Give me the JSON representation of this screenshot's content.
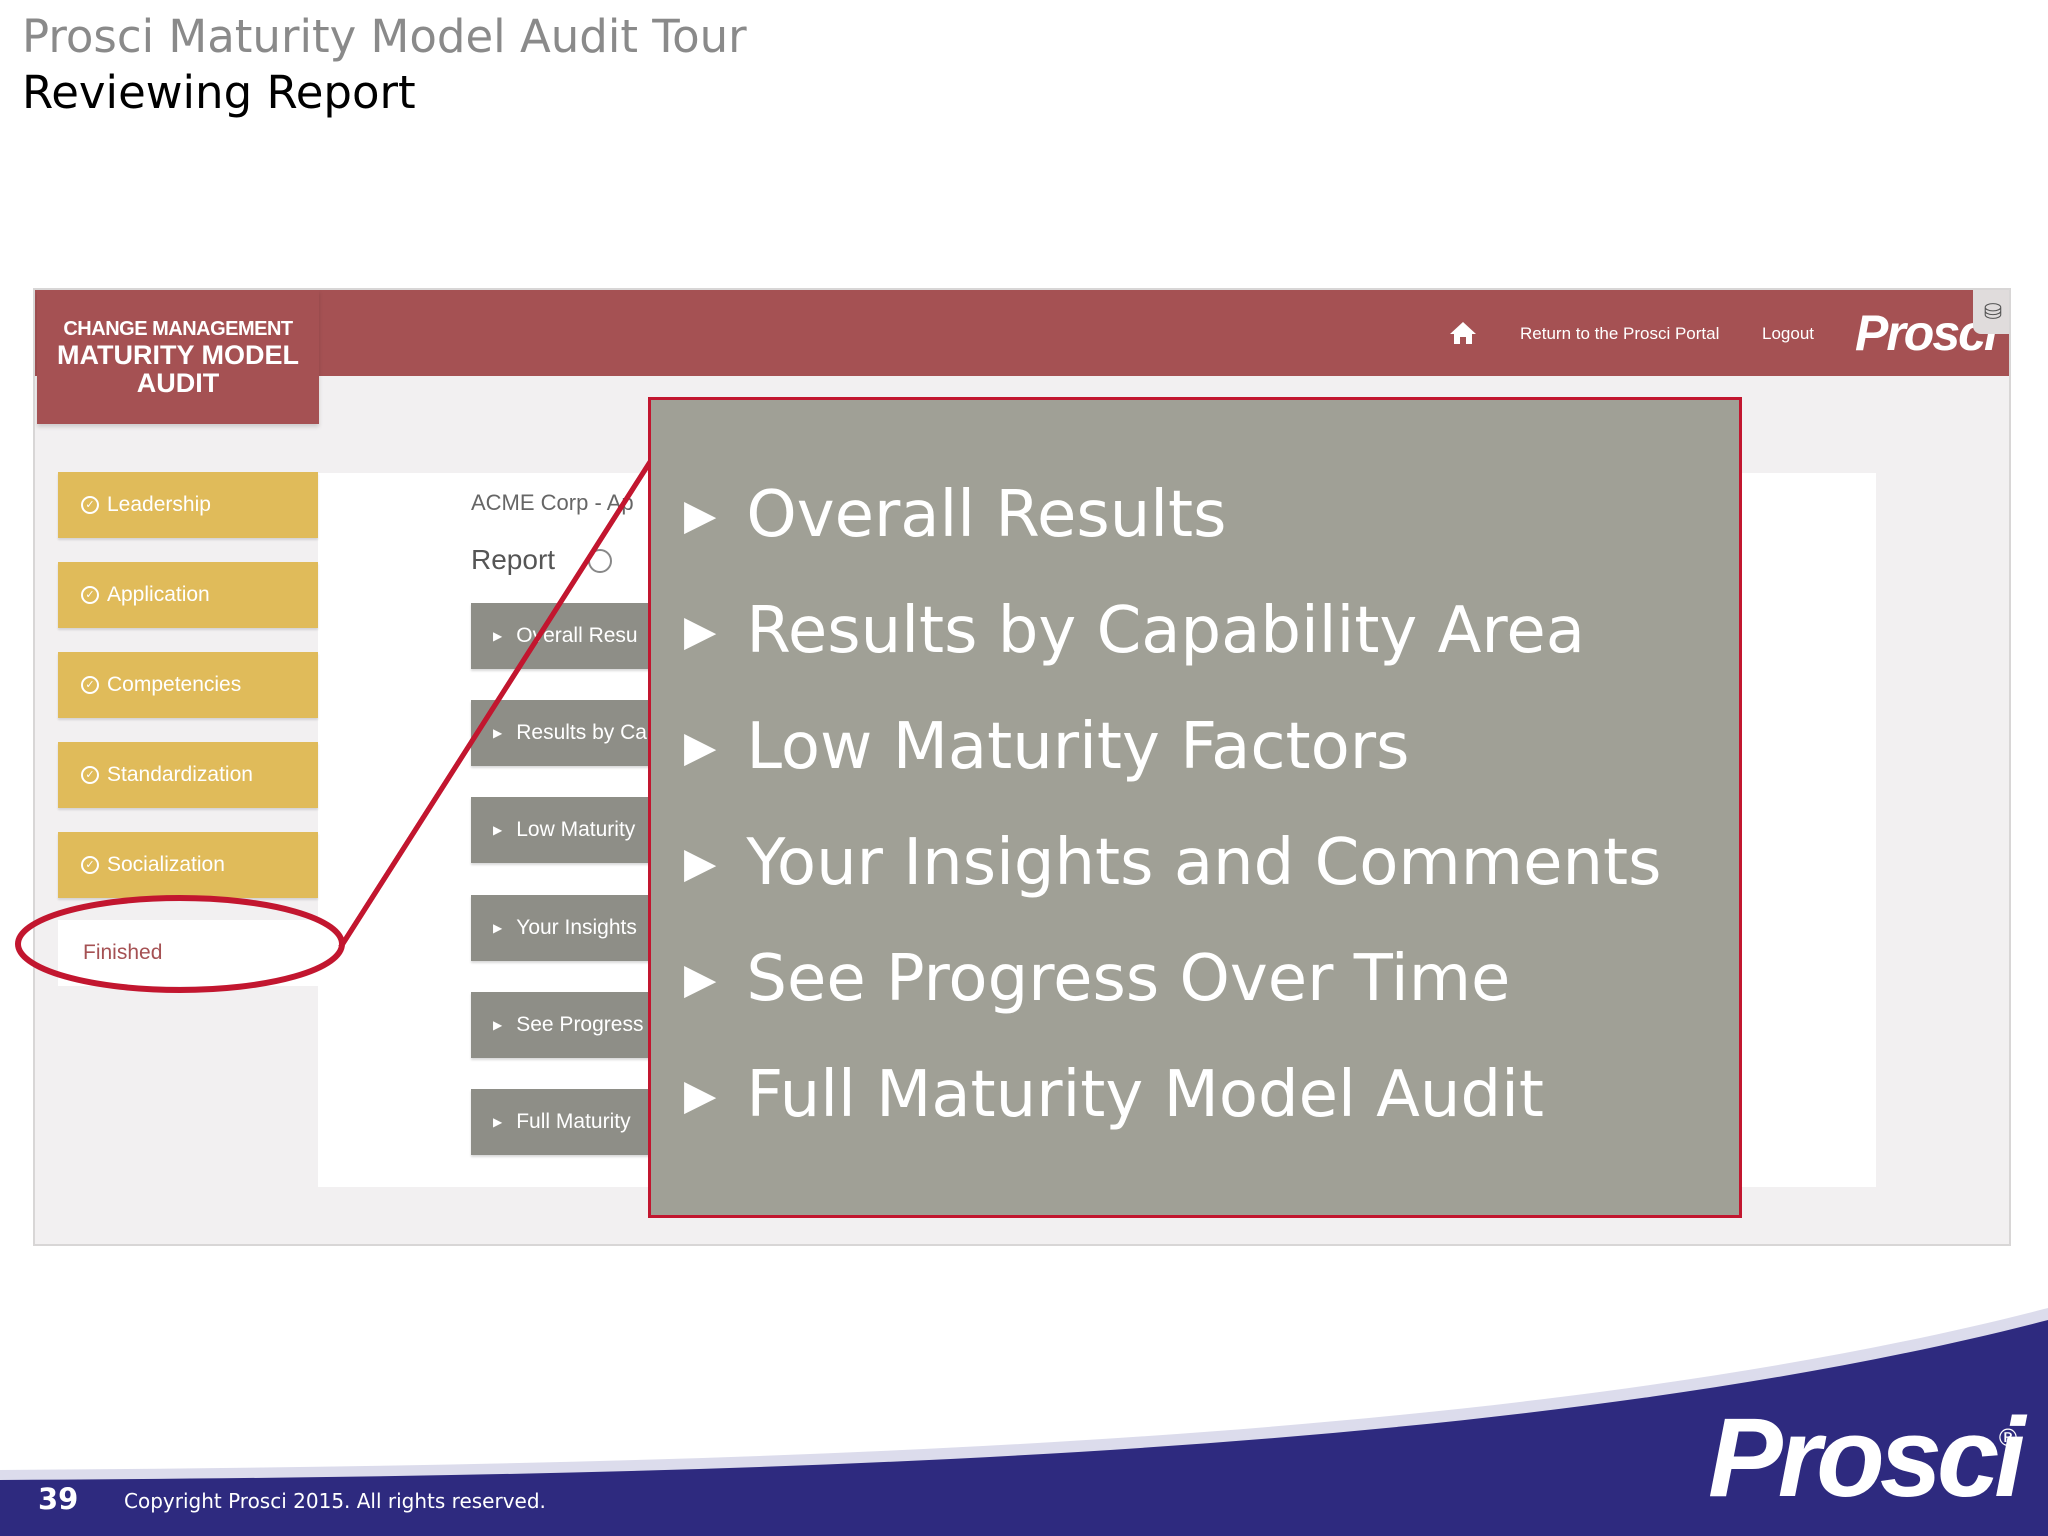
{
  "slide": {
    "title": "Prosci Maturity Model Audit Tour",
    "subtitle": "Reviewing Report"
  },
  "app": {
    "logo": {
      "line1": "CHANGE MANAGEMENT",
      "line2": "MATURITY MODEL",
      "line3": "AUDIT"
    },
    "header": {
      "home_icon": "home-icon",
      "portal_link": "Return to the Prosci Portal",
      "logout_link": "Logout",
      "brand": "Prosci"
    },
    "sidebar": {
      "items": [
        {
          "label": "Leadership",
          "icon": "check-circle-icon"
        },
        {
          "label": "Application",
          "icon": "check-circle-icon"
        },
        {
          "label": "Competencies",
          "icon": "check-circle-icon"
        },
        {
          "label": "Standardization",
          "icon": "check-circle-icon"
        },
        {
          "label": "Socialization",
          "icon": "check-circle-icon"
        }
      ],
      "finished": "Finished"
    },
    "main": {
      "breadcrumb": "ACME Corp - Ap",
      "report_title": "Report",
      "sections": [
        "Overall Resu",
        "Results by Ca",
        "Low Maturity",
        "Your Insights",
        "See Progress",
        "Full Maturity"
      ]
    }
  },
  "callout": {
    "items": [
      "Overall Results",
      "Results by Capability Area",
      "Low Maturity Factors",
      "Your Insights and Comments",
      "See Progress Over Time",
      "Full Maturity Model Audit"
    ]
  },
  "footer": {
    "page_number": "39",
    "copyright": "Copyright Prosci 2015. All rights reserved.",
    "brand": "Prosci",
    "registered": "®"
  },
  "colors": {
    "header_red": "#a55153",
    "sidebar_gold": "#e0bb5a",
    "accordion_gray": "#8e8e87",
    "callout_bg": "#a0a096",
    "highlight_red": "#c2162f",
    "footer_navy": "#2e2a7f"
  }
}
